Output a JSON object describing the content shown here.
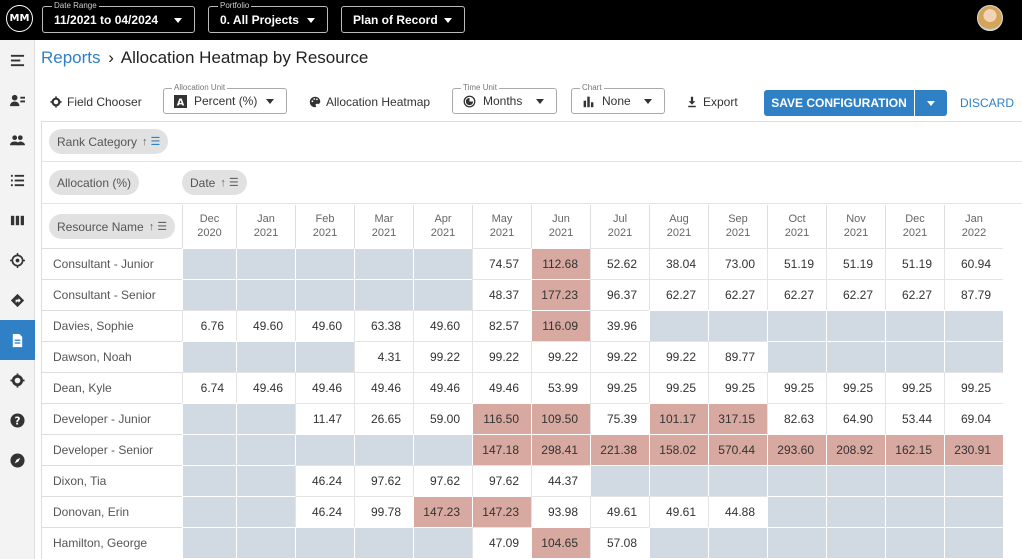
{
  "topbar": {
    "logo_text": "MM",
    "date_range": {
      "label": "Date Range",
      "value": "11/2021 to 04/2024"
    },
    "portfolio": {
      "label": "Portfolio",
      "value": "0. All Projects"
    },
    "plan": {
      "value": "Plan of Record"
    }
  },
  "sidebar": {
    "icons": [
      "menu-icon",
      "contact-card-icon",
      "people-icon",
      "list-icon",
      "columns-icon",
      "target-icon",
      "directions-icon",
      "report-icon",
      "gear-icon",
      "help-icon",
      "compass-icon"
    ],
    "active_index": 7,
    "active_color": "#2f80c4"
  },
  "breadcrumb": {
    "link": "Reports",
    "separator": "›",
    "current": "Allocation Heatmap by Resource"
  },
  "toolbar": {
    "field_chooser": "Field Chooser",
    "allocation_unit": {
      "label": "Allocation Unit",
      "value": "Percent (%)"
    },
    "heatmap": "Allocation Heatmap",
    "time_unit": {
      "label": "Time Unit",
      "value": "Months"
    },
    "chart": {
      "label": "Chart",
      "value": "None"
    },
    "export": "Export",
    "save": "SAVE CONFIGURATION",
    "discard": "DISCARD"
  },
  "grid": {
    "chips": {
      "rank_category": "Rank Category",
      "allocation": "Allocation (%)",
      "date": "Date",
      "resource_name": "Resource Name"
    },
    "columns": [
      {
        "m": "Dec",
        "y": "2020"
      },
      {
        "m": "Jan",
        "y": "2021"
      },
      {
        "m": "Feb",
        "y": "2021"
      },
      {
        "m": "Mar",
        "y": "2021"
      },
      {
        "m": "Apr",
        "y": "2021"
      },
      {
        "m": "May",
        "y": "2021"
      },
      {
        "m": "Jun",
        "y": "2021"
      },
      {
        "m": "Jul",
        "y": "2021"
      },
      {
        "m": "Aug",
        "y": "2021"
      },
      {
        "m": "Sep",
        "y": "2021"
      },
      {
        "m": "Oct",
        "y": "2021"
      },
      {
        "m": "Nov",
        "y": "2021"
      },
      {
        "m": "Dec",
        "y": "2021"
      },
      {
        "m": "Jan",
        "y": "2022"
      }
    ],
    "colors": {
      "empty": "#d1d9e3",
      "normal": "#ffffff",
      "over": "#d8a9a0"
    },
    "rows": [
      {
        "name": "Consultant - Junior",
        "values": [
          "",
          "",
          "",
          "",
          "",
          "74.57",
          "112.68",
          "52.62",
          "38.04",
          "73.00",
          "51.19",
          "51.19",
          "51.19",
          "60.94"
        ]
      },
      {
        "name": "Consultant - Senior",
        "values": [
          "",
          "",
          "",
          "",
          "",
          "48.37",
          "177.23",
          "96.37",
          "62.27",
          "62.27",
          "62.27",
          "62.27",
          "62.27",
          "87.79"
        ]
      },
      {
        "name": "Davies, Sophie",
        "values": [
          "6.76",
          "49.60",
          "49.60",
          "63.38",
          "49.60",
          "82.57",
          "116.09",
          "39.96",
          "",
          "",
          "",
          "",
          "",
          ""
        ]
      },
      {
        "name": "Dawson, Noah",
        "values": [
          "",
          "",
          "",
          "4.31",
          "99.22",
          "99.22",
          "99.22",
          "99.22",
          "99.22",
          "89.77",
          "",
          "",
          "",
          ""
        ]
      },
      {
        "name": "Dean, Kyle",
        "values": [
          "6.74",
          "49.46",
          "49.46",
          "49.46",
          "49.46",
          "49.46",
          "53.99",
          "99.25",
          "99.25",
          "99.25",
          "99.25",
          "99.25",
          "99.25",
          "99.25"
        ]
      },
      {
        "name": "Developer - Junior",
        "values": [
          "",
          "",
          "11.47",
          "26.65",
          "59.00",
          "116.50",
          "109.50",
          "75.39",
          "101.17",
          "317.15",
          "82.63",
          "64.90",
          "53.44",
          "69.04"
        ]
      },
      {
        "name": "Developer - Senior",
        "values": [
          "",
          "",
          "",
          "",
          "",
          "147.18",
          "298.41",
          "221.38",
          "158.02",
          "570.44",
          "293.60",
          "208.92",
          "162.15",
          "230.91"
        ]
      },
      {
        "name": "Dixon, Tia",
        "values": [
          "",
          "",
          "46.24",
          "97.62",
          "97.62",
          "97.62",
          "44.37",
          "",
          "",
          "",
          "",
          "",
          "",
          ""
        ]
      },
      {
        "name": "Donovan, Erin",
        "values": [
          "",
          "",
          "46.24",
          "99.78",
          "147.23",
          "147.23",
          "93.98",
          "49.61",
          "49.61",
          "44.88",
          "",
          "",
          "",
          ""
        ]
      },
      {
        "name": "Hamilton, George",
        "values": [
          "",
          "",
          "",
          "",
          "",
          "47.09",
          "104.65",
          "57.08",
          "",
          "",
          "",
          "",
          "",
          ""
        ]
      }
    ]
  }
}
